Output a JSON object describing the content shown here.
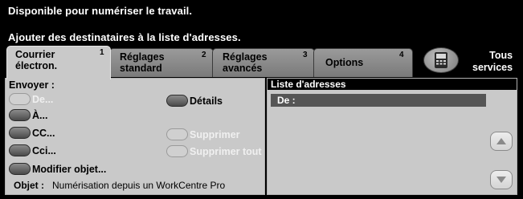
{
  "status": {
    "ready_message": "Disponible pour numériser le travail.",
    "instruction": "Ajouter des destinataires à la liste d'adresses."
  },
  "tabs": [
    {
      "line1": "Courrier",
      "line2": "électron.",
      "num": "1"
    },
    {
      "line1": "Réglages",
      "line2": "standard",
      "num": "2"
    },
    {
      "line1": "Réglages",
      "line2": "avancés",
      "num": "3"
    },
    {
      "line1": "Options",
      "line2": "",
      "num": "4"
    }
  ],
  "tous_services": {
    "line1": "Tous",
    "line2": "services"
  },
  "left_panel": {
    "envoyer_label": "Envoyer :",
    "buttons": {
      "de": "De...",
      "a": "À...",
      "cc": "CC...",
      "cci": "Cci...",
      "modifier": "Modifier objet...",
      "details": "Détails",
      "supprimer": "Supprimer",
      "supprimer_tout": "Supprimer tout"
    },
    "objet_label": "Objet :",
    "objet_value": "Numérisation depuis un WorkCentre Pro"
  },
  "address_list": {
    "header": "Liste d'adresses",
    "rows": [
      "De :"
    ]
  },
  "icons": {
    "services_button": "device-icon",
    "scroll_up": "up-arrow-icon",
    "scroll_down": "down-arrow-icon"
  }
}
